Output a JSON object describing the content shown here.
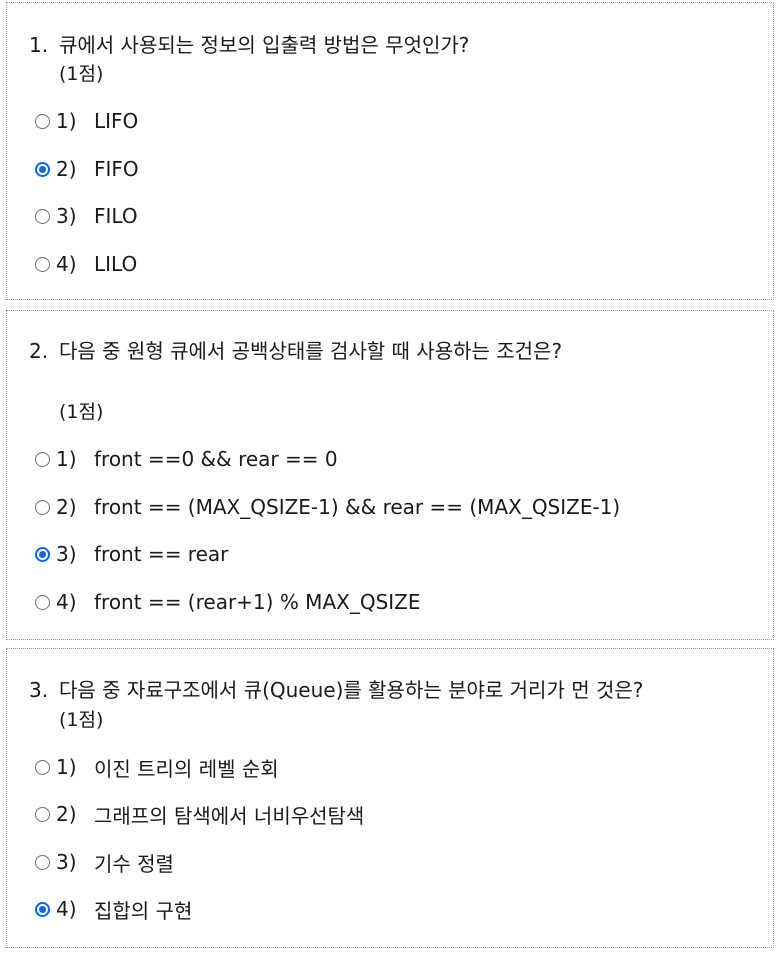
{
  "questions": [
    {
      "number": "1.",
      "text": "큐에서 사용되는 정보의 입출력 방법은 무엇인가?",
      "points": "(1점)",
      "options": [
        {
          "num": "1)",
          "text": "LIFO",
          "selected": false
        },
        {
          "num": "2)",
          "text": "FIFO",
          "selected": true
        },
        {
          "num": "3)",
          "text": "FILO",
          "selected": false
        },
        {
          "num": "4)",
          "text": "LILO",
          "selected": false
        }
      ]
    },
    {
      "number": "2.",
      "text": "다음 중 원형 큐에서 공백상태를 검사할 때 사용하는 조건은?",
      "points": "(1점)",
      "options": [
        {
          "num": "1)",
          "text": "front ==0 && rear == 0",
          "selected": false
        },
        {
          "num": "2)",
          "text": "front == (MAX_QSIZE-1) && rear == (MAX_QSIZE-1)",
          "selected": false
        },
        {
          "num": "3)",
          "text": "front == rear",
          "selected": true
        },
        {
          "num": "4)",
          "text": "front == (rear+1) % MAX_QSIZE",
          "selected": false
        }
      ]
    },
    {
      "number": "3.",
      "text": "다음 중 자료구조에서 큐(Queue)를 활용하는 분야로 거리가 먼 것은?",
      "points": "(1점)",
      "options": [
        {
          "num": "1)",
          "text": "이진 트리의 레벨 순회",
          "selected": false
        },
        {
          "num": "2)",
          "text": "그래프의 탐색에서 너비우선탐색",
          "selected": false
        },
        {
          "num": "3)",
          "text": "기수 정렬",
          "selected": false
        },
        {
          "num": "4)",
          "text": "집합의 구현",
          "selected": true
        }
      ]
    }
  ],
  "colors": {
    "radio_selected": "#0a66e8",
    "border": "#9a9a9a"
  }
}
